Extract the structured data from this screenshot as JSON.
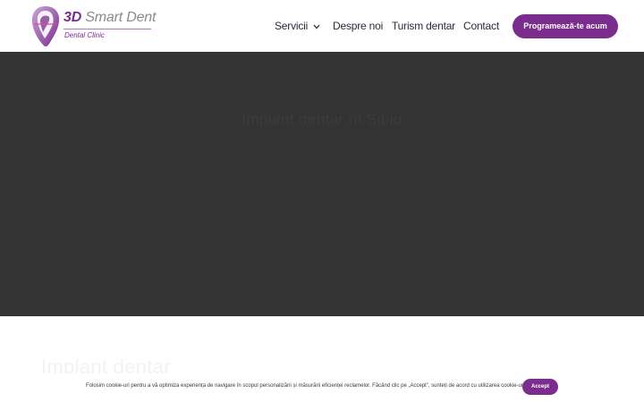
{
  "header": {
    "logo": {
      "brand_primary": "3D",
      "brand_secondary": "Smart Dent",
      "tagline": "Dental Clinic"
    },
    "nav": [
      {
        "label": "Servicii",
        "has_dropdown": true
      },
      {
        "label": "Despre noi"
      },
      {
        "label": "Turism dentar"
      },
      {
        "label": "Contact"
      }
    ],
    "cta_label": "Programează-te acum"
  },
  "hero": {
    "title": "Implant dentar în Sibiu"
  },
  "section": {
    "heading": "Implant dentar"
  },
  "cookie_bar": {
    "text": "Folosim cookie-uri pentru a vă optimiza experiența de navigare în scopul personalizării și măsurării eficienței reclamelor. Făcând clic pe „Accept”, sunteți de acord cu utilizarea cookie-urilor.",
    "accept_label": "Accept"
  },
  "colors": {
    "accent": "#7b2d8e",
    "hero_background": "#333333",
    "nav_text": "#2b2b3b"
  }
}
